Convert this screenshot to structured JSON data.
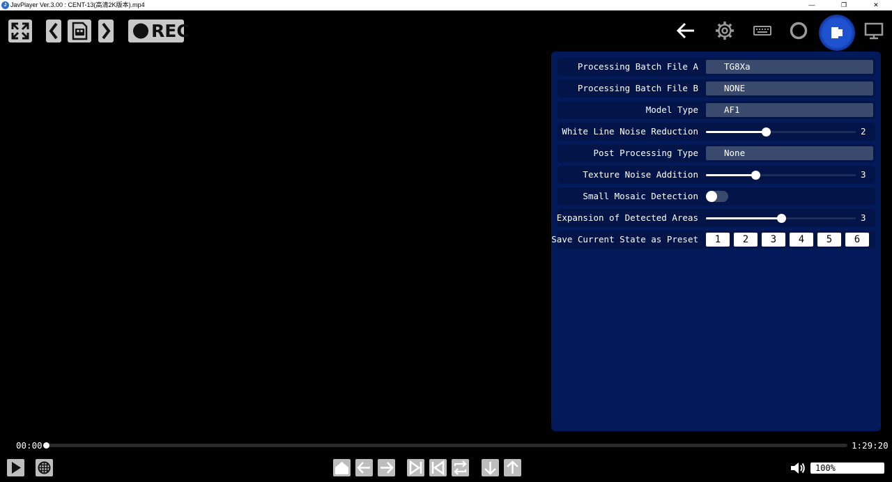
{
  "window": {
    "title": "JavPlayer Ver.3.00 : CENT-13(高清2K版本).mp4",
    "app_icon_glyph": "J",
    "minimize": "—",
    "restore": "❐",
    "close": "✕"
  },
  "toolbar": {
    "rec_label": "REC"
  },
  "settings": {
    "batch_a": {
      "label": "Processing Batch File A",
      "value": "TG8Xa"
    },
    "batch_b": {
      "label": "Processing Batch File B",
      "value": "NONE"
    },
    "model_type": {
      "label": "Model Type",
      "value": "AF1"
    },
    "white_line": {
      "label": "White Line Noise Reduction",
      "value": "2",
      "level": 0.4
    },
    "post_processing": {
      "label": "Post Processing Type",
      "value": "None"
    },
    "texture_noise": {
      "label": "Texture Noise Addition",
      "value": "3",
      "level": 0.33
    },
    "small_mosaic": {
      "label": "Small Mosaic Detection",
      "on": false
    },
    "expansion": {
      "label": "Expansion of Detected Areas",
      "value": "3",
      "level": 0.5
    },
    "preset": {
      "label": "Save Current State as Preset",
      "buttons": [
        "1",
        "2",
        "3",
        "4",
        "5",
        "6"
      ]
    }
  },
  "playback": {
    "current_time": "00:00",
    "duration": "1:29:20",
    "progress": 0.0,
    "volume": "100%"
  },
  "colors": {
    "panel": "#031a5a",
    "row": "#021448",
    "value_box": "#3a4a6d",
    "active_icon": "#1f52d0"
  }
}
